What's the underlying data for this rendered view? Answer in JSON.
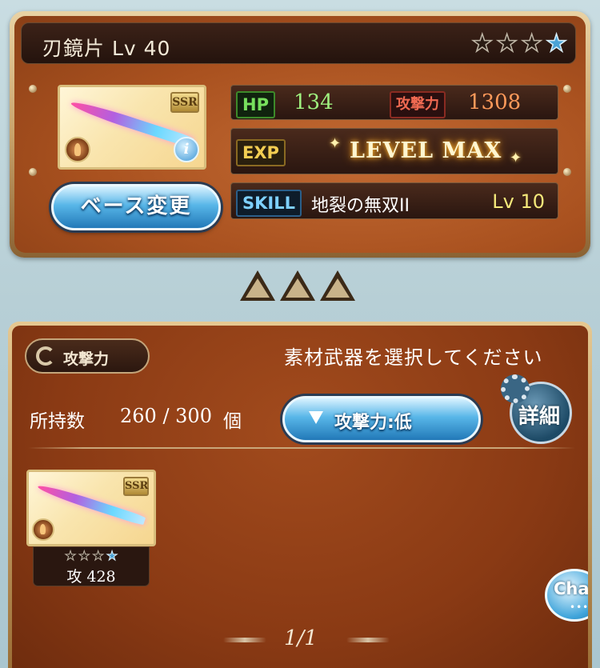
{
  "weapon": {
    "name_level": "刃鏡片 Lv 40",
    "rarity_badge": "SSR",
    "stars_total": 4,
    "stars_uncapped": 1,
    "hp_label": "HP",
    "hp_value": "134",
    "atk_label": "攻撃力",
    "atk_value": "1308",
    "exp_label": "EXP",
    "exp_status": "LEVEL MAX",
    "skill_label": "SKILL",
    "skill_name": "地裂の無双II",
    "skill_level": "Lv 10",
    "change_base_label": "ベース変更",
    "info_icon_glyph": "i"
  },
  "materials": {
    "sort_chip_label": "攻撃力",
    "instruction": "素材武器を選択してください",
    "owned_label": "所持数",
    "owned_count": "260 / 300",
    "owned_unit": "個",
    "filter_label": "攻撃力:低",
    "detail_label": "詳細",
    "items": [
      {
        "rarity_badge": "SSR",
        "attack_text": "攻 428",
        "stars_total": 4,
        "stars_uncapped": 1
      }
    ],
    "pager": "1/1",
    "chat_label": "Chat",
    "chat_dots": "•••"
  },
  "colors": {
    "hp": "#9ff07f",
    "attack": "#ff9a5a",
    "skill_level": "#f4e87a",
    "button_blue": "#58b6e8",
    "panel_brown": "#8a3a14"
  }
}
